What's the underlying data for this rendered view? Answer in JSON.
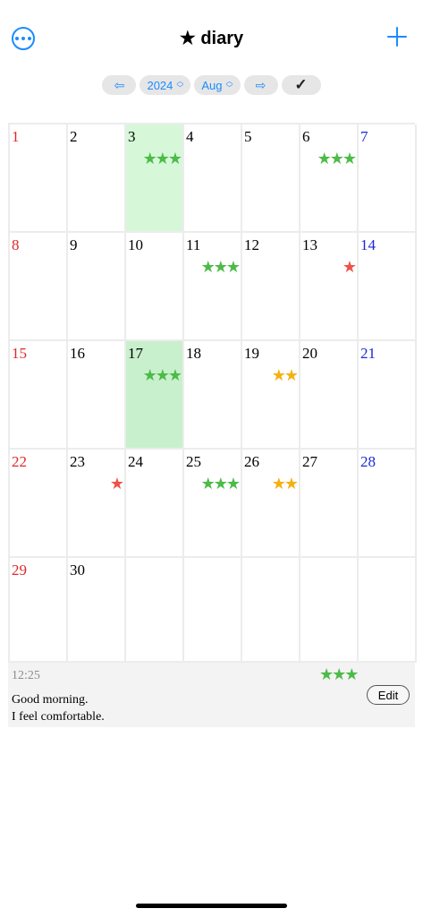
{
  "header": {
    "title": "★ diary",
    "more_icon": "ellipsis-circle-icon",
    "add_icon": "plus-icon"
  },
  "toolbar": {
    "prev": "⇦",
    "year": "2024",
    "month": "Aug",
    "next": "⇨",
    "check": "✓"
  },
  "calendar": {
    "weeks": [
      [
        {
          "day": "1",
          "kind": "sun",
          "stars": "",
          "color": ""
        },
        {
          "day": "2",
          "kind": "",
          "stars": "",
          "color": ""
        },
        {
          "day": "3",
          "kind": "",
          "stars": "★★★",
          "color": "green",
          "hl": "light"
        },
        {
          "day": "4",
          "kind": "",
          "stars": "",
          "color": ""
        },
        {
          "day": "5",
          "kind": "",
          "stars": "",
          "color": ""
        },
        {
          "day": "6",
          "kind": "",
          "stars": "★★★",
          "color": "green"
        },
        {
          "day": "7",
          "kind": "sat",
          "stars": "",
          "color": ""
        }
      ],
      [
        {
          "day": "8",
          "kind": "sun",
          "stars": "",
          "color": ""
        },
        {
          "day": "9",
          "kind": "",
          "stars": "",
          "color": ""
        },
        {
          "day": "10",
          "kind": "",
          "stars": "",
          "color": ""
        },
        {
          "day": "11",
          "kind": "",
          "stars": "★★★",
          "color": "green"
        },
        {
          "day": "12",
          "kind": "",
          "stars": "",
          "color": ""
        },
        {
          "day": "13",
          "kind": "",
          "stars": "★",
          "color": "red"
        },
        {
          "day": "14",
          "kind": "sat",
          "stars": "",
          "color": ""
        }
      ],
      [
        {
          "day": "15",
          "kind": "sun",
          "stars": "",
          "color": ""
        },
        {
          "day": "16",
          "kind": "",
          "stars": "",
          "color": ""
        },
        {
          "day": "17",
          "kind": "",
          "stars": "★★★",
          "color": "green",
          "hl": "mid"
        },
        {
          "day": "18",
          "kind": "",
          "stars": "",
          "color": ""
        },
        {
          "day": "19",
          "kind": "",
          "stars": "★★",
          "color": "orange"
        },
        {
          "day": "20",
          "kind": "",
          "stars": "",
          "color": ""
        },
        {
          "day": "21",
          "kind": "sat",
          "stars": "",
          "color": ""
        }
      ],
      [
        {
          "day": "22",
          "kind": "sun",
          "stars": "",
          "color": ""
        },
        {
          "day": "23",
          "kind": "",
          "stars": "★",
          "color": "red"
        },
        {
          "day": "24",
          "kind": "",
          "stars": "",
          "color": ""
        },
        {
          "day": "25",
          "kind": "",
          "stars": "★★★",
          "color": "green"
        },
        {
          "day": "26",
          "kind": "",
          "stars": "★★",
          "color": "orange"
        },
        {
          "day": "27",
          "kind": "",
          "stars": "",
          "color": ""
        },
        {
          "day": "28",
          "kind": "sat",
          "stars": "",
          "color": ""
        }
      ],
      [
        {
          "day": "29",
          "kind": "sun",
          "stars": "",
          "color": ""
        },
        {
          "day": "30",
          "kind": "",
          "stars": "",
          "color": ""
        },
        {
          "day": "",
          "kind": "",
          "stars": "",
          "color": ""
        },
        {
          "day": "",
          "kind": "",
          "stars": "",
          "color": ""
        },
        {
          "day": "",
          "kind": "",
          "stars": "",
          "color": ""
        },
        {
          "day": "",
          "kind": "",
          "stars": "",
          "color": ""
        },
        {
          "day": "",
          "kind": "",
          "stars": "",
          "color": ""
        }
      ]
    ]
  },
  "detail": {
    "time": "12:25",
    "stars": "★★★",
    "line1": "Good morning.",
    "line2": "I feel comfortable.",
    "edit_label": "Edit"
  },
  "colors": {
    "accent": "#1a8cff",
    "sunday": "#e0282b",
    "saturday": "#1a2ad6",
    "star_green": "#4cbb47",
    "star_orange": "#f5b111",
    "star_red": "#ee5246",
    "highlight": "#d6f8d9"
  }
}
